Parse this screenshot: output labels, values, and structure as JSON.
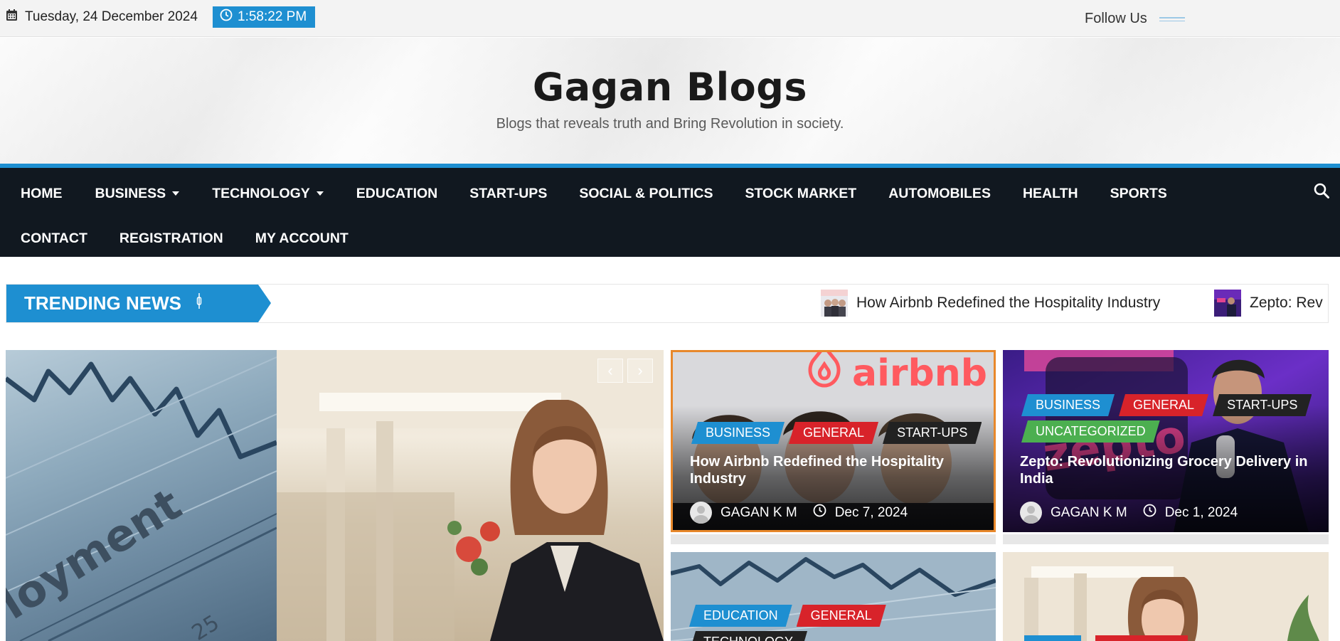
{
  "topbar": {
    "date": "Tuesday, 24 December 2024",
    "time": "1:58:22 PM",
    "follow_label": "Follow Us",
    "icons": {
      "date": "calendar-icon",
      "time": "clock-icon"
    }
  },
  "header": {
    "site_title": "Gagan Blogs",
    "tagline": "Blogs that reveals truth and Bring Revolution in society."
  },
  "nav": {
    "items_row1": [
      "HOME",
      "BUSINESS",
      "TECHNOLOGY",
      "EDUCATION",
      "START-UPS",
      "SOCIAL & POLITICS",
      "STOCK MARKET",
      "AUTOMOBILES",
      "HEALTH",
      "SPORTS"
    ],
    "items_row2": [
      "CONTACT",
      "REGISTRATION",
      "MY ACCOUNT"
    ],
    "dropdown_items": [
      "BUSINESS",
      "TECHNOLOGY"
    ],
    "search_icon": "search-icon"
  },
  "trending": {
    "label": "TRENDING NEWS",
    "items": [
      {
        "title": "How Airbnb Redefined the Hospitality Industry"
      },
      {
        "title": "Zepto: Rev"
      }
    ]
  },
  "slider": {
    "controls": {
      "prev": "‹",
      "next": "›"
    }
  },
  "cards": [
    {
      "tags": [
        "BUSINESS",
        "GENERAL",
        "START-UPS"
      ],
      "title": "How Airbnb Redefined the Hospitality Industry",
      "author": "GAGAN K M",
      "date": "Dec 7, 2024",
      "brand_text": "airbnb"
    },
    {
      "tags": [
        "BUSINESS",
        "GENERAL",
        "START-UPS",
        "UNCATEGORIZED"
      ],
      "title": "Zepto: Revolutionizing Grocery Delivery in India",
      "author": "GAGAN K M",
      "date": "Dec 1, 2024"
    },
    {
      "tags": [
        "EDUCATION",
        "GENERAL",
        "TECHNOLOGY"
      ]
    },
    {
      "tags": []
    }
  ],
  "colors": {
    "accent": "#1e8fd1",
    "nav_bg": "#111820",
    "tag_business": "#1e8fd1",
    "tag_general": "#d8232a",
    "tag_dark": "#222222",
    "tag_uncategorized": "#4caf50",
    "airbnb": "#ff5a5f",
    "card_border_highlight": "#e8882b"
  }
}
